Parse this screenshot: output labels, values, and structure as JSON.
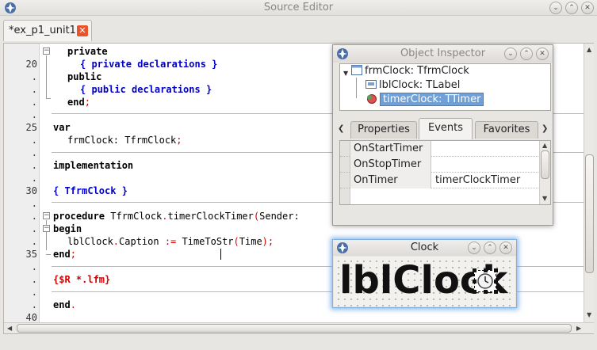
{
  "window": {
    "title": "Source Editor",
    "buttons": [
      "⌄",
      "⌃",
      "✕"
    ]
  },
  "tab": {
    "label": "*ex_p1_unit1",
    "close": "✕"
  },
  "gutter": [
    "",
    "20",
    ".",
    ".",
    ".",
    ".",
    "25",
    ".",
    ".",
    ".",
    ".",
    "30",
    ".",
    ".",
    ".",
    ".",
    "35",
    ".",
    ".",
    ".",
    ".",
    "40"
  ],
  "code": {
    "l0": "private",
    "l1": "{ private declarations }",
    "l2": "public",
    "l3": "{ public declarations }",
    "l4_kw": "end",
    "l4_sym": ";",
    "l6": "var",
    "l7_a": "frmClock",
    "l7_b": ": TfrmClock",
    "l7_c": ";",
    "l9": "implementation",
    "l11": "{ TfrmClock }",
    "l13_kw": "procedure",
    "l13_b": " TfrmClock",
    "l13_c": ".",
    "l13_d": "timerClockTimer",
    "l13_e": "(",
    "l13_f": "Sender:",
    "l14": "begin",
    "l15_a": "lblClock",
    "l15_b": ".",
    "l15_c": "Caption ",
    "l15_d": ":=",
    "l15_e": " TimeToStr",
    "l15_f": "(",
    "l15_g": "Time",
    "l15_h": ");",
    "l16_kw": "end",
    "l16_sym": ";",
    "l18": "{$R *.lfm}",
    "l20_kw": "end",
    "l20_sym": "."
  },
  "inspector": {
    "title": "Object Inspector",
    "buttons": [
      "⌄",
      "⌃",
      "✕"
    ],
    "tree": {
      "root": "frmClock: TfrmClock",
      "child1": "lblClock: TLabel",
      "child2": "timerClock: TTimer"
    },
    "tabs": [
      "Properties",
      "Events",
      "Favorites"
    ],
    "active_tab": "Events",
    "rows": [
      {
        "name": "OnStartTimer",
        "value": ""
      },
      {
        "name": "OnStopTimer",
        "value": ""
      },
      {
        "name": "OnTimer",
        "value": "timerClockTimer"
      }
    ]
  },
  "clock_form": {
    "title": "Clock",
    "buttons": [
      "⌄",
      "⌃",
      "✕"
    ],
    "label_caption": "lblClock"
  },
  "colors": {
    "comment": "#0000c8",
    "directive": "#d40000",
    "symbol": "#d40000",
    "selection": "#6fa1d8",
    "focus_glow": "#60a0e6"
  }
}
